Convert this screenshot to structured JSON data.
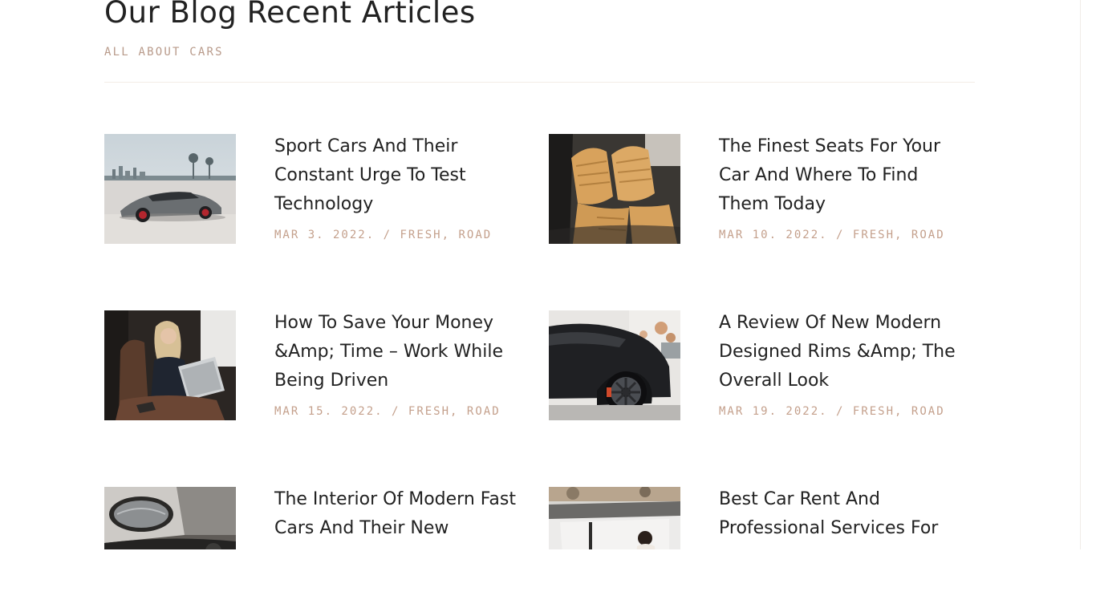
{
  "header": {
    "title": "Our Blog Recent Articles",
    "subtitle": "ALL ABOUT CARS"
  },
  "articles": [
    {
      "title": "Sport Cars And Their Constant Urge To Test Technology",
      "date": "MAR 3. 2022.",
      "separator": "/",
      "categories": [
        "FRESH",
        "ROAD"
      ]
    },
    {
      "title": "The Finest Seats For Your Car And Where To Find Them Today",
      "date": "MAR 10. 2022.",
      "separator": "/",
      "categories": [
        "FRESH",
        "ROAD"
      ]
    },
    {
      "title": "How To Save Your Money &Amp; Time – Work While Being Driven",
      "date": "MAR 15. 2022.",
      "separator": "/",
      "categories": [
        "FRESH",
        "ROAD"
      ]
    },
    {
      "title": "A Review Of New Modern Designed Rims &Amp; The Overall Look",
      "date": "MAR 19. 2022.",
      "separator": "/",
      "categories": [
        "FRESH",
        "ROAD"
      ]
    },
    {
      "title": "The Interior Of Modern Fast Cars And Their New",
      "date": "",
      "separator": "",
      "categories": []
    },
    {
      "title": "Best Car Rent And Professional Services For",
      "date": "",
      "separator": "",
      "categories": []
    }
  ],
  "colors": {
    "accent": "#c4a08c",
    "subtitle": "#b89a8a",
    "text": "#222222",
    "divider": "#f3ece6"
  },
  "icons": {
    "thumb_1": "grey-sports-car-image",
    "thumb_2": "tan-leather-seats-image",
    "thumb_3": "woman-with-laptop-in-car-image",
    "thumb_4": "black-car-rim-image",
    "thumb_5": "car-side-mirror-image",
    "thumb_6": "woman-in-car-window-image"
  }
}
